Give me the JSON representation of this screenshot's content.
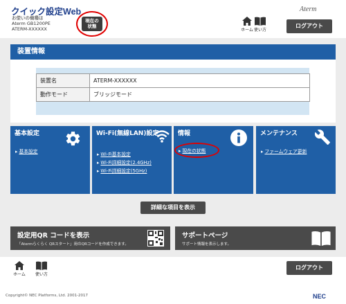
{
  "header": {
    "app_title": "クイック設定Web",
    "device_line1": "お使いの機種は",
    "device_line2": "Aterm GB1200PE",
    "device_line3": "ATERM-XXXXXX",
    "status_button_line1": "現在の",
    "status_button_line2": "状態",
    "brand": "Aterm",
    "home_label": "ホーム",
    "help_label": "使い方",
    "logout_label": "ログアウト"
  },
  "device_info": {
    "title": "装置情報",
    "rows": [
      {
        "key": "装置名",
        "value": "ATERM-XXXXXX"
      },
      {
        "key": "動作モード",
        "value": "ブリッジモード"
      }
    ]
  },
  "cards": [
    {
      "title": "基本設定",
      "links": [
        "基本設定"
      ],
      "icon": "gear-icon"
    },
    {
      "title": "Wi-Fi(無線LAN)設定",
      "links": [
        "Wi-Fi基本設定",
        "Wi-Fi詳細設定(2.4GHz)",
        "Wi-Fi詳細設定(5GHz)"
      ],
      "icon": "wifi-icon"
    },
    {
      "title": "情報",
      "links": [
        "現在の状態"
      ],
      "icon": "info-icon"
    },
    {
      "title": "メンテナンス",
      "links": [
        "ファームウェア更新"
      ],
      "icon": "wrench-icon"
    }
  ],
  "details_button": "詳細な項目を表示",
  "qr_card": {
    "title": "設定用QR コードを表示",
    "subtitle": "「Atermらくらく QRスタート」用のQRコードを作成できます。",
    "icon": "qr-code-icon"
  },
  "support_card": {
    "title": "サポートページ",
    "subtitle": "サポート情報を表示します。",
    "icon": "book-icon"
  },
  "footer": {
    "home_label": "ホーム",
    "help_label": "使い方",
    "logout_label": "ログアウト",
    "copyright": "Copyright© NEC Platforms, Ltd. 2001-2017",
    "brand": "NEC"
  },
  "colors": {
    "primary_blue": "#1f5fa6",
    "dark_button": "#4a4a4a",
    "highlight_red": "#e00000",
    "light_blue_box": "#d2e5f3"
  }
}
